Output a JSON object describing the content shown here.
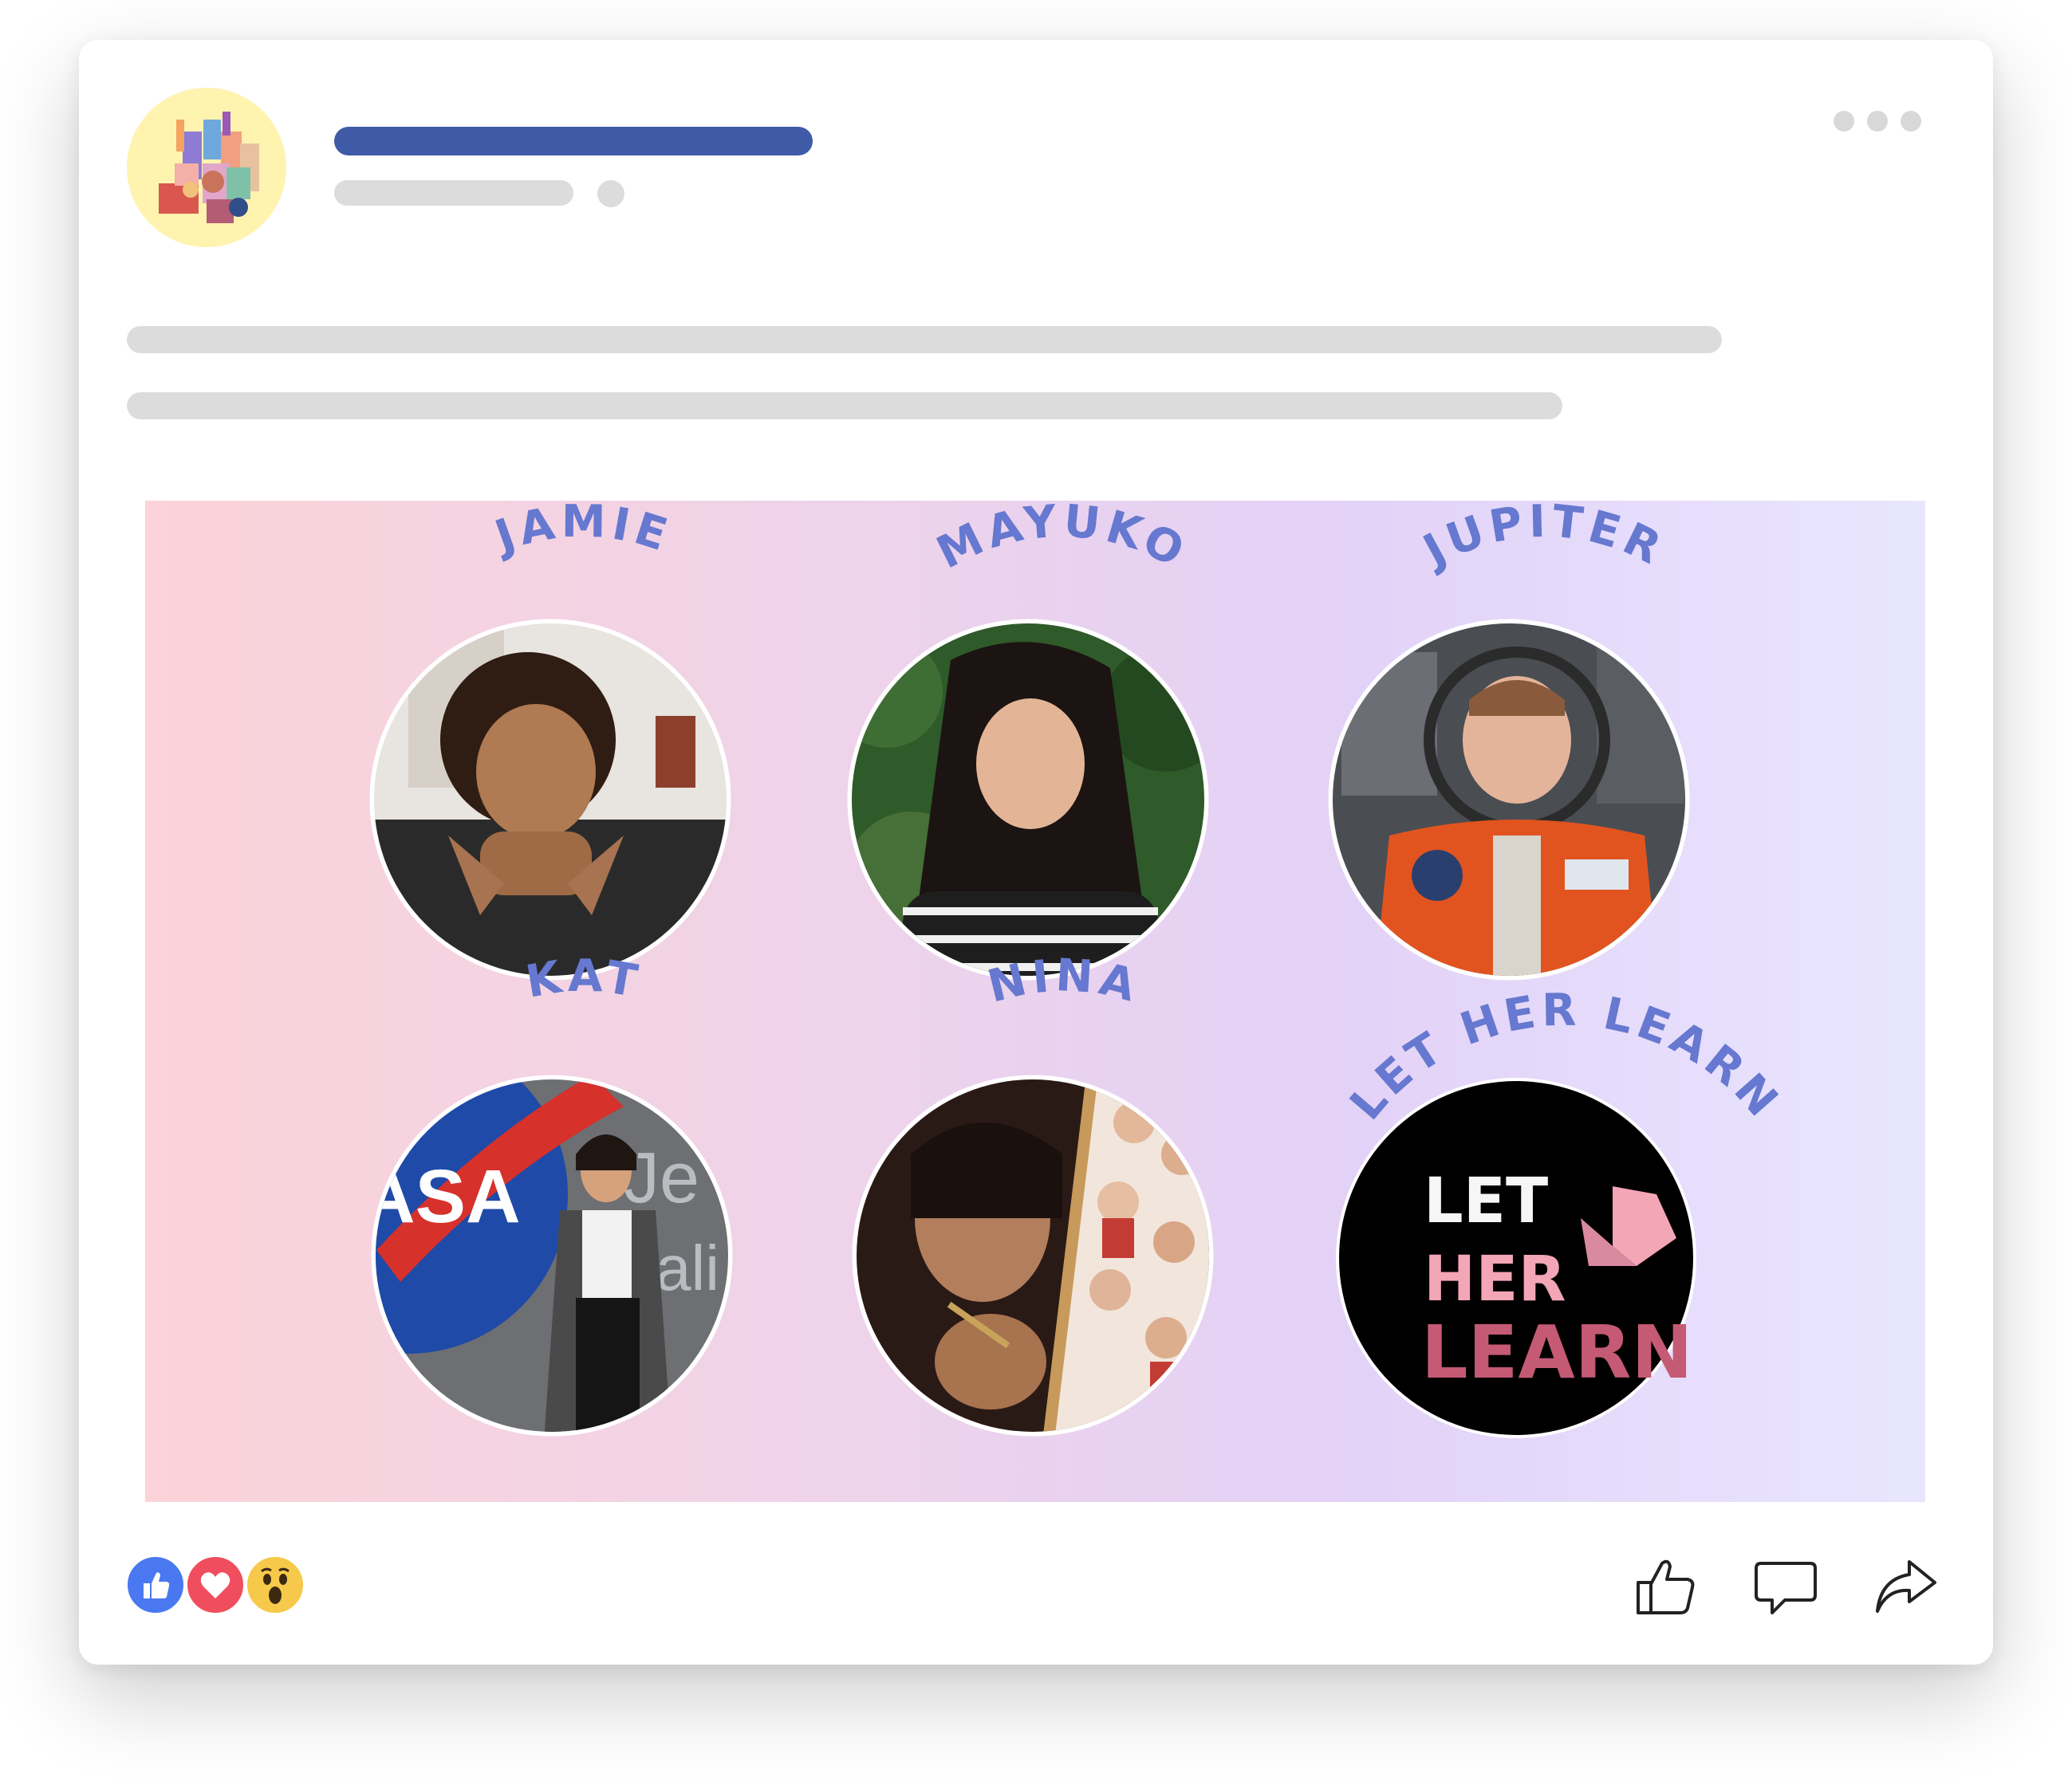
{
  "post": {
    "header": {
      "avatar_icon": "community-illustration-icon",
      "more_icon": "more-options-icon"
    },
    "banner": {
      "profiles": [
        {
          "name": "JAMIE",
          "photo_icon": "jamie-photo"
        },
        {
          "name": "MAYUKO",
          "photo_icon": "mayuko-photo"
        },
        {
          "name": "JUPITER",
          "photo_icon": "jupiter-photo"
        },
        {
          "name": "KAT",
          "photo_icon": "kat-photo"
        },
        {
          "name": "NINA",
          "photo_icon": "nina-photo"
        },
        {
          "name": "LET HER LEARN",
          "photo_icon": "let-her-learn-logo"
        }
      ],
      "logo": {
        "line1": "LET",
        "line2": "HER",
        "line3": "LEARN"
      },
      "colors": {
        "name_text": "#6678cf",
        "gradient_left": "#fbd3d8",
        "gradient_right": "#e8e6ff"
      }
    },
    "reactions": [
      "like-reaction-icon",
      "love-reaction-icon",
      "wow-reaction-icon"
    ],
    "actions": [
      {
        "name": "like",
        "icon": "thumbs-up-icon"
      },
      {
        "name": "comment",
        "icon": "comment-icon"
      },
      {
        "name": "share",
        "icon": "share-arrow-icon"
      }
    ]
  }
}
